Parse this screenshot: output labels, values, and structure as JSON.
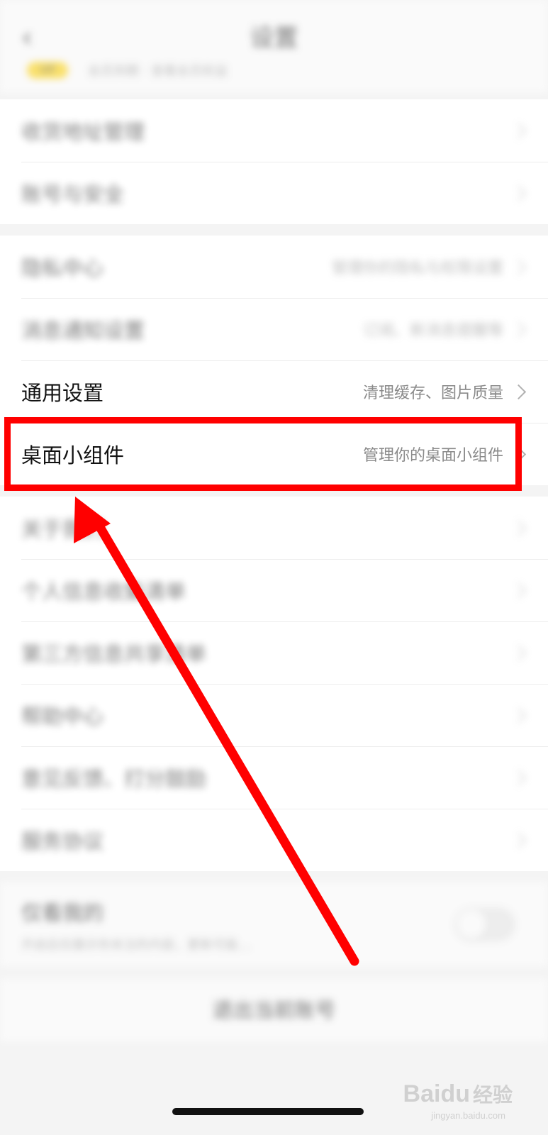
{
  "header": {
    "back_icon": "chevron-left-icon",
    "title": "设置",
    "vip_label": "VIP",
    "account_text": "会员到期 · 查看会员权益"
  },
  "section1": {
    "items": [
      {
        "label": "收货地址管理"
      },
      {
        "label": "账号与安全"
      }
    ]
  },
  "section2": {
    "items": [
      {
        "label": "隐私中心",
        "value": "管理你的隐私与权限设置"
      },
      {
        "label": "消息通知设置",
        "value": "订阅、新消息提醒等"
      },
      {
        "label": "通用设置",
        "value": "清理缓存、图片质量"
      },
      {
        "label": "桌面小组件",
        "value": "管理你的桌面小组件"
      }
    ]
  },
  "section3": {
    "items": [
      {
        "label": "关于我们"
      },
      {
        "label": "个人信息收集清单"
      },
      {
        "label": "第三方信息共享清单"
      },
      {
        "label": "帮助中心"
      },
      {
        "label": "意见反馈、打分鼓励"
      },
      {
        "label": "服务协议"
      }
    ]
  },
  "section4": {
    "label": "仅看我的",
    "description": "开启后仅展示你关注的内容，更新可能…"
  },
  "logout_label": "退出当前账号",
  "watermark": {
    "logo": "Baidu",
    "text": "经验",
    "url": "jingyan.baidu.com"
  },
  "colors": {
    "highlight": "#ff0000",
    "vip": "#ffd200",
    "background": "#f4f4f4"
  }
}
